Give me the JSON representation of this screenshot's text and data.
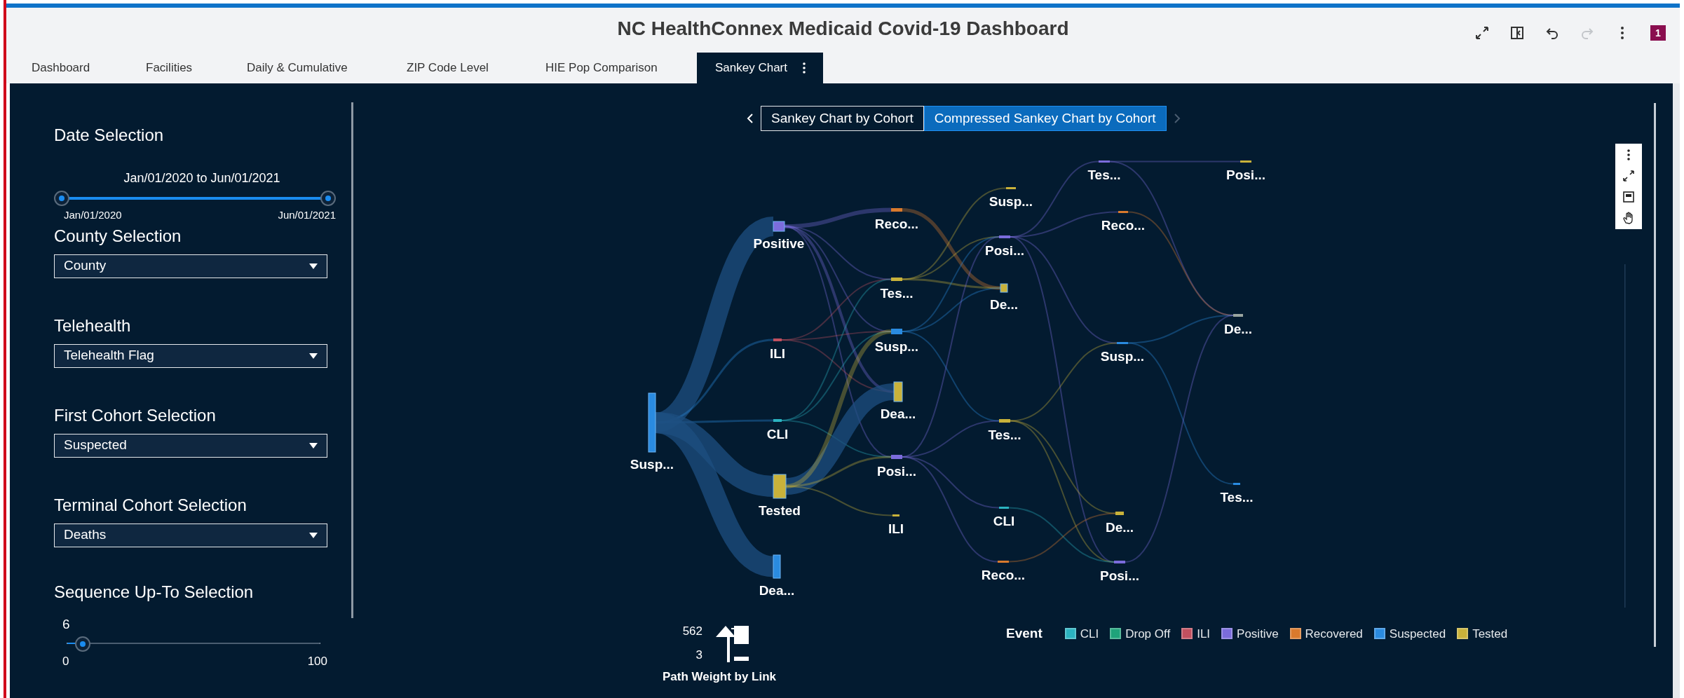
{
  "title": "NC HealthConnex Medicaid Covid-19 Dashboard",
  "header_actions": [
    {
      "kind": "expand",
      "disabled": false
    },
    {
      "kind": "panel",
      "disabled": false
    },
    {
      "kind": "undo",
      "disabled": false
    },
    {
      "kind": "redo",
      "disabled": true
    },
    {
      "kind": "more",
      "disabled": false
    }
  ],
  "badge": "1",
  "tabs": [
    {
      "label": "Dashboard",
      "selected": false
    },
    {
      "label": "Facilities",
      "selected": false
    },
    {
      "label": "Daily & Cumulative",
      "selected": false
    },
    {
      "label": "ZIP Code Level",
      "selected": false
    },
    {
      "label": "HIE Pop Comparison",
      "selected": false
    },
    {
      "label": "Sankey Chart",
      "selected": true
    }
  ],
  "filters": {
    "date_selection": {
      "label": "Date Selection",
      "range_text": "Jan/01/2020 to Jun/01/2021",
      "start_label": "Jan/01/2020",
      "end_label": "Jun/01/2021",
      "level": 1
    },
    "dropdowns": [
      {
        "label": "County Selection",
        "value": "County"
      },
      {
        "label": "Telehealth",
        "value": "Telehealth Flag"
      },
      {
        "label": "First Cohort Selection",
        "value": "Suspected"
      },
      {
        "label": "Terminal Cohort Selection",
        "value": "Deaths"
      }
    ],
    "sequence": {
      "label": "Sequence Up-To Selection",
      "value": "6",
      "min": "0",
      "max": "100",
      "level": 0.06
    }
  },
  "sankey": {
    "view_buttons": [
      {
        "label": "Sankey Chart by Cohort",
        "selected": false
      },
      {
        "label": "Compressed Sankey Chart by Cohort",
        "selected": true
      }
    ],
    "stages": [
      [
        {
          "label": "Susp...",
          "color": "#2a8be0"
        }
      ],
      [
        {
          "label": "Positive",
          "color": "#7b6cdc"
        },
        {
          "label": "ILI",
          "color": "#c2505f"
        },
        {
          "label": "CLI",
          "color": "#2bb3c0"
        },
        {
          "label": "Tested",
          "color": "#c9b23a"
        },
        {
          "label": "Dea...",
          "color": "#2a8be0"
        }
      ],
      [
        {
          "label": "Reco...",
          "color": "#d97a2d"
        },
        {
          "label": "Tes...",
          "color": "#c9b23a"
        },
        {
          "label": "Susp...",
          "color": "#2a8be0"
        },
        {
          "label": "Dea...",
          "color": "#c9b23a"
        },
        {
          "label": "Posi...",
          "color": "#7b6cdc"
        },
        {
          "label": "ILI",
          "color": "#c9b23a"
        }
      ],
      [
        {
          "label": "Susp...",
          "color": "#c9b23a"
        },
        {
          "label": "Posi...",
          "color": "#7b6cdc"
        },
        {
          "label": "De...",
          "color": "#c9b23a"
        },
        {
          "label": "Tes...",
          "color": "#c9b23a"
        },
        {
          "label": "CLI",
          "color": "#2bb3c0"
        },
        {
          "label": "Reco...",
          "color": "#d97a2d"
        }
      ],
      [
        {
          "label": "Tes...",
          "color": "#7b6cdc"
        },
        {
          "label": "Reco...",
          "color": "#d97a2d"
        },
        {
          "label": "Susp...",
          "color": "#2a8be0"
        },
        {
          "label": "De...",
          "color": "#c9b23a"
        },
        {
          "label": "Posi...",
          "color": "#7b6cdc"
        }
      ],
      [
        {
          "label": "Posi...",
          "color": "#c9b23a"
        },
        {
          "label": "De...",
          "color": "#9aa5a0"
        },
        {
          "label": "Tes...",
          "color": "#2a8be0"
        }
      ]
    ],
    "weight_legend": {
      "max": "562",
      "min": "3",
      "title": "Path Weight by Link"
    },
    "legend": {
      "title": "Event",
      "items": [
        {
          "label": "CLI",
          "color": "#2bb3c0"
        },
        {
          "label": "Drop Off",
          "color": "#1fa37a"
        },
        {
          "label": "ILI",
          "color": "#c2505f"
        },
        {
          "label": "Positive",
          "color": "#7b6cdc"
        },
        {
          "label": "Recovered",
          "color": "#d97a2d"
        },
        {
          "label": "Suspected",
          "color": "#2a8be0"
        },
        {
          "label": "Tested",
          "color": "#c9b23a"
        }
      ]
    }
  }
}
